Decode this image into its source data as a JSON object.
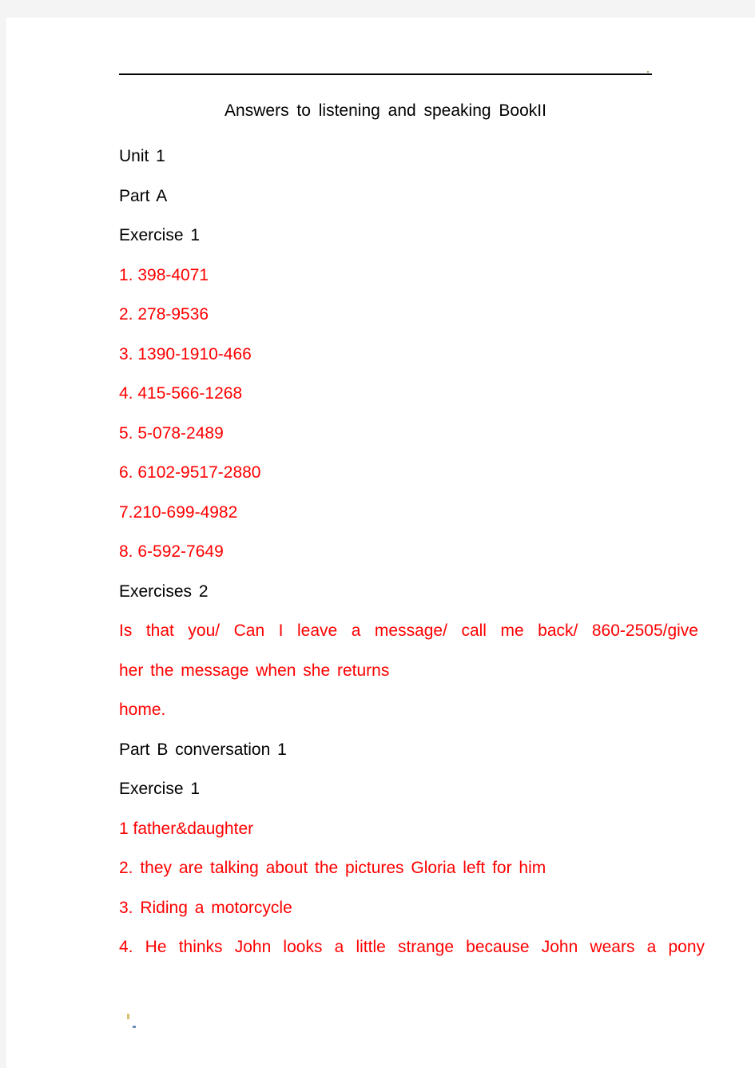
{
  "document": {
    "title": "Answers to listening and speaking BookII",
    "text_color_body": "#000000",
    "text_color_answers": "#ff0000",
    "page_background": "#ffffff",
    "canvas_background": "#f4f4f4"
  },
  "sections": {
    "unit_heading": "Unit 1",
    "part_a_heading": "Part A",
    "exercise_1_heading": "Exercise 1",
    "exercises_2_heading": "Exercises 2",
    "part_b_heading": "Part B conversation 1",
    "part_b_exercise_1_heading": "Exercise 1"
  },
  "exercise_1_answers": [
    "1. 398-4071",
    "2. 278-9536",
    "3. 1390-1910-466",
    "4. 415-566-1268",
    "5. 5-078-2489",
    "6. 6102-9517-2880",
    "7.210-699-4982",
    "8. 6-592-7649"
  ],
  "exercises_2_answer": {
    "line_1": "Is that you/ Can I leave a message/ call me back/ 860-2505/give",
    "line_2": "her the message when she returns",
    "line_3": "home."
  },
  "part_b_exercise_1_answers": {
    "item_1": "1 father&daughter",
    "item_2": "2. they are talking about the pictures Gloria left for him",
    "item_3": "3. Riding a motorcycle",
    "item_4": "4. He thinks John looks a little strange because John wears a pony"
  }
}
